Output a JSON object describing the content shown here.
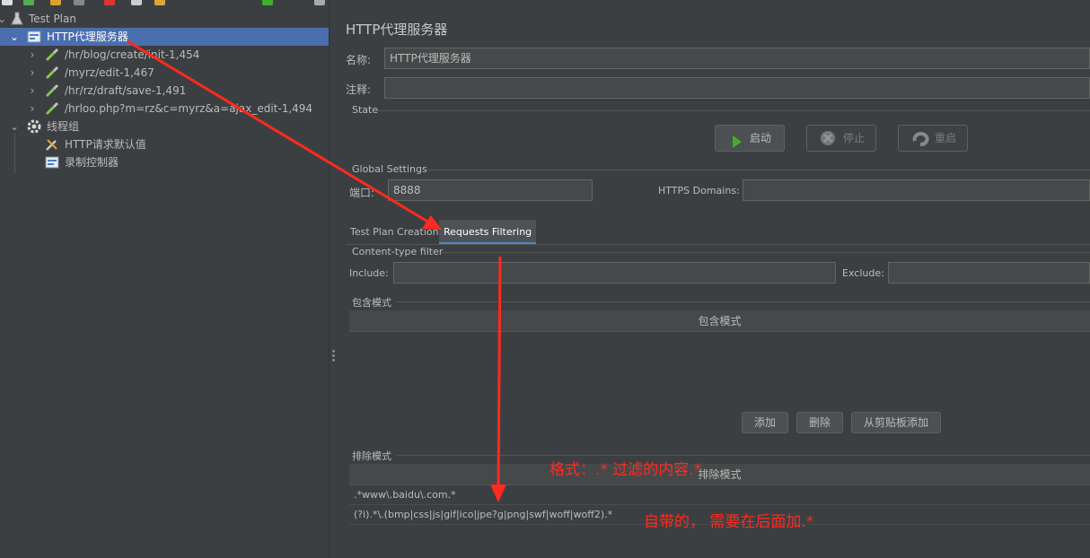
{
  "tree": {
    "items": [
      {
        "label": "Test Plan",
        "icon": "flask-icon"
      },
      {
        "label": "HTTP代理服务器",
        "icon": "proxy-server-icon"
      },
      {
        "label": "/hr/blog/create/init-1,454",
        "icon": "pipette-icon"
      },
      {
        "label": "/myrz/edit-1,467",
        "icon": "pipette-icon"
      },
      {
        "label": "/hr/rz/draft/save-1,491",
        "icon": "pipette-icon"
      },
      {
        "label": "/hrloo.php?m=rz&c=myrz&a=ajax_edit-1,494",
        "icon": "pipette-icon"
      },
      {
        "label": "线程组",
        "icon": "gear-icon"
      },
      {
        "label": "HTTP请求默认值",
        "icon": "wrench-icon"
      },
      {
        "label": "录制控制器",
        "icon": "recorder-icon"
      }
    ]
  },
  "panel": {
    "title": "HTTP代理服务器",
    "name_label": "名称:",
    "name_value": "HTTP代理服务器",
    "comment_label": "注释:",
    "comment_value": "",
    "state_label": "State",
    "start_button": "启动",
    "stop_button": "停止",
    "restart_button": "重启",
    "global_settings_label": "Global Settings",
    "port_label": "端口:",
    "port_value": "8888",
    "https_domains_label": "HTTPS Domains:",
    "https_domains_value": "",
    "tabs": [
      {
        "label": "Test Plan Creation",
        "active": false
      },
      {
        "label": "Requests Filtering",
        "active": true
      }
    ],
    "content_type_filter_label": "Content-type filter",
    "include_label": "Include:",
    "include_value": "",
    "exclude_label": "Exclude:",
    "exclude_value": "",
    "include_patterns_section": "包含模式",
    "include_patterns_header": "包含模式",
    "add_button": "添加",
    "delete_button": "删除",
    "paste_button": "从剪贴板添加",
    "exclude_patterns_section": "排除模式",
    "exclude_patterns_header": "排除模式",
    "exclude_rows": [
      ".*www\\.baidu\\.com.*",
      "(?i).*\\.(bmp|css|js|gif|ico|jpe?g|png|swf|woff|woff2).*"
    ]
  },
  "annotations": {
    "format_note": "格式：.* 过滤的内容.*",
    "builtin_note": "自带的，  需要在后面加.*",
    "color": "#ff2a1f"
  },
  "colors": {
    "background": "#3c3f41",
    "selection": "#4b6eaf",
    "field": "#45494a",
    "start_green": "#3fae29"
  }
}
